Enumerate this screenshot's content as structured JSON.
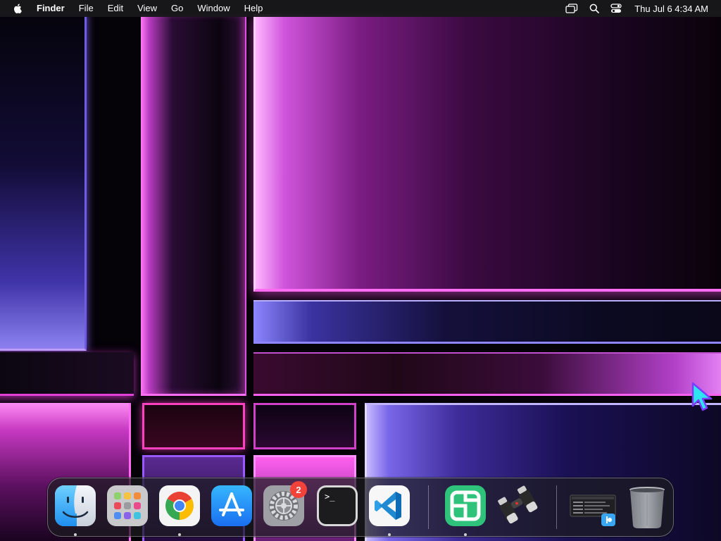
{
  "menubar": {
    "app_name": "Finder",
    "menus": [
      "File",
      "Edit",
      "View",
      "Go",
      "Window",
      "Help"
    ],
    "clock": "Thu Jul 6  4:34 AM"
  },
  "dock": {
    "settings_badge": "2",
    "terminal_prompt": ">_"
  },
  "icons": {
    "apple": "apple-icon",
    "screen_mirroring": "screen-mirroring-icon",
    "spotlight": "search-icon",
    "control_center": "control-center-icon"
  },
  "colors": {
    "menubar_bg": "#18181a",
    "badge": "#f2423a",
    "cursor": "#2ee6f0"
  }
}
